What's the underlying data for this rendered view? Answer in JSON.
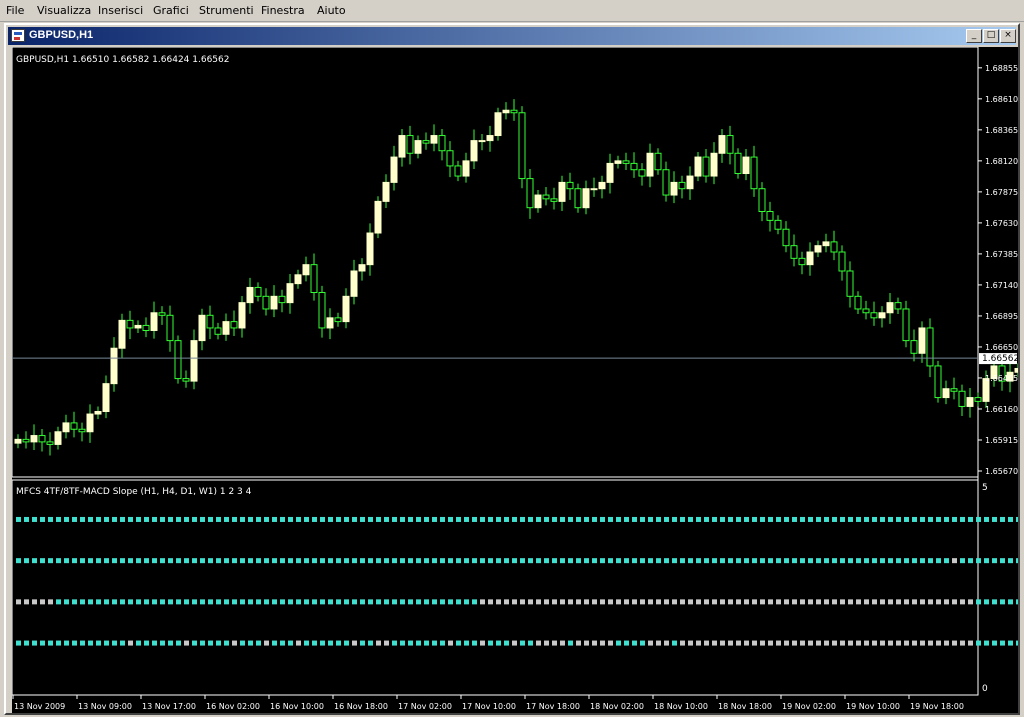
{
  "menu": {
    "items": [
      {
        "label": "File"
      },
      {
        "label": "Visualizza"
      },
      {
        "label": "Inserisci"
      },
      {
        "label": "Grafici"
      },
      {
        "label": "Strumenti"
      },
      {
        "label": "Finestra"
      },
      {
        "label": "Aiuto"
      }
    ]
  },
  "window": {
    "title": "GBPUSD,H1",
    "icon": "chart-window-icon",
    "buttons": {
      "minimize": "_",
      "maximize": "□",
      "close": "×"
    }
  },
  "main_chart": {
    "info": "GBPUSD,H1  1.66510 1.66582 1.66424 1.66562",
    "current_price_label": "1.66562",
    "price_ticks": [
      "1.68855",
      "1.68610",
      "1.68365",
      "1.68120",
      "1.67875",
      "1.67630",
      "1.67385",
      "1.67140",
      "1.66895",
      "1.66650",
      "1.66405",
      "1.66160",
      "1.65915",
      "1.65670"
    ]
  },
  "indicator": {
    "label": "MFCS 4TF/8TF-MACD Slope (H1, H4, D1, W1) 1 2 3 4",
    "scale_top": "5",
    "scale_bottom": "0"
  },
  "time_ticks": [
    "13 Nov 2009",
    "13 Nov 09:00",
    "13 Nov 17:00",
    "16 Nov 02:00",
    "16 Nov 10:00",
    "16 Nov 18:00",
    "17 Nov 02:00",
    "17 Nov 10:00",
    "17 Nov 18:00",
    "18 Nov 02:00",
    "18 Nov 10:00",
    "18 Nov 18:00",
    "19 Nov 02:00",
    "19 Nov 10:00",
    "19 Nov 18:00"
  ],
  "colors": {
    "background": "#000000",
    "candle_up": "#ffffcc",
    "candle_wick": "#33ff33",
    "bid_line": "#778899",
    "text": "#ffffff",
    "dot_cyan": "#40e0d0",
    "dot_gray": "#c8c8c8"
  },
  "chart_data": {
    "type": "candlestick",
    "symbol": "GBPUSD",
    "timeframe": "H1",
    "ylim": [
      1.6567,
      1.6898
    ],
    "last_ohlc": {
      "open": 1.6651,
      "high": 1.66582,
      "low": 1.66424,
      "close": 1.66562
    },
    "current_price": 1.66562,
    "close_series": [
      1.6592,
      1.659,
      1.6595,
      1.659,
      1.6588,
      1.6598,
      1.6605,
      1.66,
      1.6598,
      1.6612,
      1.6614,
      1.6636,
      1.6664,
      1.6686,
      1.668,
      1.6682,
      1.6678,
      1.6692,
      1.669,
      1.667,
      1.664,
      1.6638,
      1.667,
      1.669,
      1.668,
      1.6675,
      1.6685,
      1.668,
      1.67,
      1.6712,
      1.6705,
      1.6695,
      1.6705,
      1.67,
      1.6715,
      1.6722,
      1.673,
      1.6708,
      1.668,
      1.6688,
      1.6685,
      1.6705,
      1.6725,
      1.673,
      1.6755,
      1.678,
      1.6795,
      1.6815,
      1.6832,
      1.6818,
      1.6828,
      1.6826,
      1.6832,
      1.682,
      1.6808,
      1.68,
      1.6812,
      1.6828,
      1.6828,
      1.6832,
      1.685,
      1.6852,
      1.685,
      1.6798,
      1.6775,
      1.6785,
      1.6782,
      1.678,
      1.6795,
      1.679,
      1.6775,
      1.679,
      1.679,
      1.6795,
      1.681,
      1.6812,
      1.681,
      1.6805,
      1.68,
      1.6818,
      1.6805,
      1.6785,
      1.6795,
      1.679,
      1.68,
      1.6815,
      1.68,
      1.6818,
      1.6832,
      1.6818,
      1.6802,
      1.6815,
      1.679,
      1.6772,
      1.6765,
      1.6758,
      1.6745,
      1.6735,
      1.673,
      1.674,
      1.6745,
      1.6748,
      1.674,
      1.6725,
      1.6705,
      1.6695,
      1.6692,
      1.6688,
      1.6692,
      1.67,
      1.6695,
      1.667,
      1.666,
      1.668,
      1.665,
      1.6625,
      1.6632,
      1.663,
      1.6618,
      1.6625,
      1.6622,
      1.664,
      1.665,
      1.6638,
      1.6645,
      1.6648,
      1.665,
      1.666,
      1.6645,
      1.6656
    ],
    "indicator_rows": [
      {
        "level": 4,
        "gray_indices": []
      },
      {
        "level": 3,
        "gray_indices": [
          117
        ]
      },
      {
        "level": 2,
        "gray_indices": [
          0,
          1,
          2,
          3,
          4,
          58,
          59,
          60,
          61,
          62,
          63,
          64,
          65,
          66,
          67,
          68,
          69,
          70,
          71,
          72,
          73,
          74,
          75,
          76,
          77,
          78,
          79,
          80,
          81,
          82,
          83,
          84,
          85,
          86,
          87,
          88,
          89,
          90,
          91,
          92,
          93,
          94,
          95,
          96,
          97,
          98,
          99,
          100,
          101,
          102,
          103,
          104,
          105,
          106,
          107,
          108,
          109,
          110,
          111,
          112,
          113,
          114,
          115,
          116,
          117,
          118,
          119
        ]
      },
      {
        "level": 1,
        "gray_indices": [
          14,
          21,
          27,
          31,
          35,
          42,
          45,
          46,
          54,
          58,
          62,
          65,
          66,
          67,
          68,
          70,
          71,
          72,
          73,
          74,
          79,
          80,
          81,
          83,
          84,
          85,
          86,
          87,
          88,
          89,
          90,
          91,
          92,
          93,
          94,
          95,
          96,
          97,
          98,
          99,
          100,
          101,
          102,
          103,
          104,
          105,
          106,
          107,
          108,
          109,
          110,
          111,
          112,
          113,
          114,
          115,
          116,
          117,
          118,
          119
        ]
      }
    ],
    "indicator_ylim": [
      0,
      5
    ]
  }
}
